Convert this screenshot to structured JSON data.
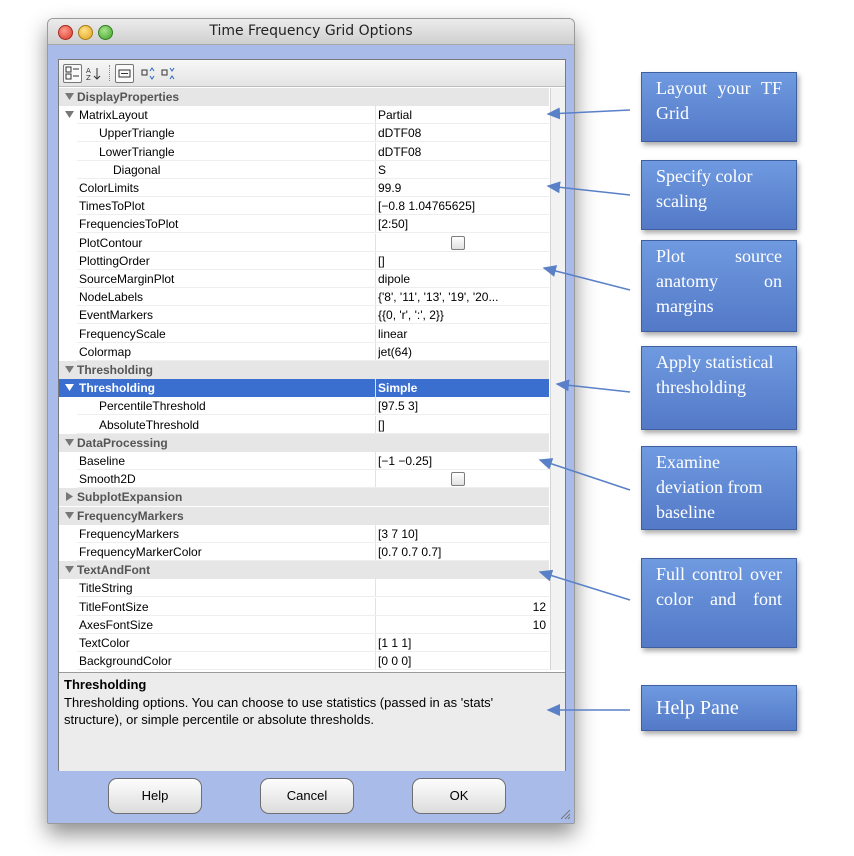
{
  "window": {
    "title": "Time Frequency Grid Options"
  },
  "toolbar": {
    "buttons": [
      "categorized-view",
      "sort-alphabetical",
      "property-editor",
      "expand-all",
      "collapse-all"
    ]
  },
  "grid": {
    "rows": [
      {
        "kind": "category",
        "name": "DisplayProperties",
        "expanded": true
      },
      {
        "kind": "prop",
        "name": "MatrixLayout",
        "value": "Partial",
        "indent": 1,
        "expander": "open"
      },
      {
        "kind": "prop",
        "name": "UpperTriangle",
        "value": "dDTF08",
        "indent": 2
      },
      {
        "kind": "prop",
        "name": "LowerTriangle",
        "value": "dDTF08",
        "indent": 2
      },
      {
        "kind": "prop",
        "name": "Diagonal",
        "value": "S",
        "indent": 3
      },
      {
        "kind": "prop",
        "name": "ColorLimits",
        "value": "99.9",
        "indent": 1
      },
      {
        "kind": "prop",
        "name": "TimesToPlot",
        "value": "[−0.8 1.04765625]",
        "indent": 1
      },
      {
        "kind": "prop",
        "name": "FrequenciesToPlot",
        "value": "[2:50]",
        "indent": 1
      },
      {
        "kind": "prop",
        "name": "PlotContour",
        "value": "",
        "indent": 1,
        "checkbox": true
      },
      {
        "kind": "prop",
        "name": "PlottingOrder",
        "value": "[]",
        "indent": 1
      },
      {
        "kind": "prop",
        "name": "SourceMarginPlot",
        "value": "dipole",
        "indent": 1
      },
      {
        "kind": "prop",
        "name": "NodeLabels",
        "value": "{'8', '11', '13', '19', '20...",
        "indent": 1
      },
      {
        "kind": "prop",
        "name": "EventMarkers",
        "value": "{{0, 'r', ':', 2}}",
        "indent": 1
      },
      {
        "kind": "prop",
        "name": "FrequencyScale",
        "value": "linear",
        "indent": 1
      },
      {
        "kind": "prop",
        "name": "Colormap",
        "value": "jet(64)",
        "indent": 1
      },
      {
        "kind": "category",
        "name": "Thresholding",
        "expanded": true
      },
      {
        "kind": "prop",
        "name": "Thresholding",
        "value": "Simple",
        "indent": 1,
        "expander": "open",
        "selected": true
      },
      {
        "kind": "prop",
        "name": "PercentileThreshold",
        "value": "[97.5 3]",
        "indent": 2
      },
      {
        "kind": "prop",
        "name": "AbsoluteThreshold",
        "value": "[]",
        "indent": 2
      },
      {
        "kind": "category",
        "name": "DataProcessing",
        "expanded": true
      },
      {
        "kind": "prop",
        "name": "Baseline",
        "value": "[−1 −0.25]",
        "indent": 1
      },
      {
        "kind": "prop",
        "name": "Smooth2D",
        "value": "",
        "indent": 1,
        "checkbox": true
      },
      {
        "kind": "category",
        "name": "SubplotExpansion",
        "expanded": false
      },
      {
        "kind": "category",
        "name": "FrequencyMarkers",
        "expanded": true
      },
      {
        "kind": "prop",
        "name": "FrequencyMarkers",
        "value": "[3 7 10]",
        "indent": 1
      },
      {
        "kind": "prop",
        "name": "FrequencyMarkerColor",
        "value": "[0.7 0.7 0.7]",
        "indent": 1
      },
      {
        "kind": "category",
        "name": "TextAndFont",
        "expanded": true
      },
      {
        "kind": "prop",
        "name": "TitleString",
        "value": "",
        "indent": 1
      },
      {
        "kind": "prop",
        "name": "TitleFontSize",
        "value": "12",
        "indent": 1,
        "numeric": true
      },
      {
        "kind": "prop",
        "name": "AxesFontSize",
        "value": "10",
        "indent": 1,
        "numeric": true
      },
      {
        "kind": "prop",
        "name": "TextColor",
        "value": "[1 1 1]",
        "indent": 1
      },
      {
        "kind": "prop",
        "name": "BackgroundColor",
        "value": "[0 0 0]",
        "indent": 1
      }
    ]
  },
  "help": {
    "title": "Thresholding",
    "text": "Thresholding options.  You can choose to use statistics (passed in as 'stats' structure), or simple percentile or absolute thresholds."
  },
  "buttons": {
    "help": "Help",
    "cancel": "Cancel",
    "ok": "OK"
  },
  "callouts": [
    {
      "text": "Layout  your TF Grid",
      "target_row": 1
    },
    {
      "text": "Specify color scaling",
      "target_row": 5
    },
    {
      "text": "Plot  source anatomy  on margins",
      "target_row": 10
    },
    {
      "text": "Apply statistical thresholding",
      "target_row": 16
    },
    {
      "text": "Examine deviation from baseline",
      "target_row": 20
    },
    {
      "text": "Full  control over  color and font",
      "target_row": 26
    },
    {
      "text": "Help Pane",
      "target_row": "help"
    }
  ],
  "colors": {
    "selection": "#3a6fd0",
    "callout": "#5f88d6",
    "window_body": "#a9bce9"
  }
}
